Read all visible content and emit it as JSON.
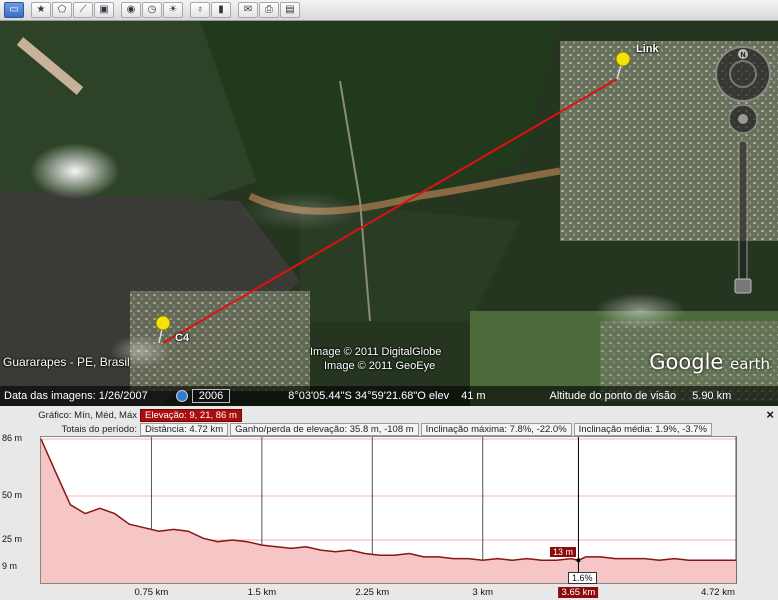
{
  "toolbar": {
    "buttons": [
      {
        "name": "sidebar-toggle-icon",
        "glyph": "▭",
        "active": true
      },
      {
        "name": "placemark-icon",
        "glyph": "★"
      },
      {
        "name": "polygon-icon",
        "glyph": "⬠"
      },
      {
        "name": "path-icon",
        "glyph": "⟋"
      },
      {
        "name": "image-overlay-icon",
        "glyph": "▣"
      },
      {
        "name": "tour-icon",
        "glyph": "◉"
      },
      {
        "name": "historical-imagery-icon",
        "glyph": "◷"
      },
      {
        "name": "sunlight-icon",
        "glyph": "☀"
      },
      {
        "name": "planet-icon",
        "glyph": "♁"
      },
      {
        "name": "ruler-icon",
        "glyph": "▮"
      },
      {
        "name": "email-icon",
        "glyph": "✉"
      },
      {
        "name": "print-icon",
        "glyph": "⎙"
      },
      {
        "name": "save-image-icon",
        "glyph": "▤"
      }
    ]
  },
  "map": {
    "pins": {
      "link": "Link",
      "c4": "C4"
    },
    "place_label": "Guararapes - PE, Brasil",
    "credit1": "Image © 2011 DigitalGlobe",
    "credit2": "Image © 2011 GeoEye",
    "logo_word": "Google",
    "logo_suffix": "earth",
    "path_color": "#e01010"
  },
  "status": {
    "date_label": "Data das imagens: 1/26/2007",
    "year": "2006",
    "coords": "8°03'05.44\"S   34°59'21.68\"O  elev",
    "elev": "41 m",
    "eye_label": "Altitude do ponto de visão",
    "eye_value": "5.90 km"
  },
  "profile": {
    "row1_label": "Gráfico: Mín, Méd, Máx",
    "elevation_summary": "Elevação: 9, 21, 86 m",
    "row2_label": "Totais do período:",
    "distance": "Distância: 4.72 km",
    "gain_loss": "Ganho/perda de elevação: 35.8 m, -108 m",
    "max_slope": "Inclinação máxima: 7.8%, -22.0%",
    "avg_slope": "Inclinação média: 1.9%, -3.7%",
    "close": "×",
    "cursor_elev": "13 m",
    "cursor_slope": "1.6%",
    "cursor_dist": "3.65 km",
    "fill_color": "#f6c6c6",
    "line_color": "#8a1414"
  },
  "chart_data": {
    "type": "area",
    "xlabel": "",
    "ylabel": "",
    "y_ticks": [
      "86 m",
      "50 m",
      "25 m",
      "9 m"
    ],
    "x_ticks": [
      "0.75 km",
      "1.5 km",
      "2.25 km",
      "3 km",
      "3.65 km",
      "4.72 km"
    ],
    "xlim": [
      0,
      4.72
    ],
    "ylim": [
      9,
      86
    ],
    "x": [
      0,
      0.1,
      0.2,
      0.3,
      0.4,
      0.5,
      0.6,
      0.7,
      0.8,
      0.9,
      1.0,
      1.1,
      1.2,
      1.3,
      1.4,
      1.5,
      1.6,
      1.7,
      1.8,
      1.9,
      2.0,
      2.1,
      2.2,
      2.3,
      2.4,
      2.5,
      2.6,
      2.7,
      2.8,
      2.9,
      3.0,
      3.1,
      3.2,
      3.3,
      3.4,
      3.5,
      3.6,
      3.65,
      3.7,
      3.8,
      3.9,
      4.0,
      4.1,
      4.2,
      4.3,
      4.4,
      4.5,
      4.6,
      4.72
    ],
    "y": [
      86,
      65,
      45,
      40,
      43,
      40,
      34,
      32,
      30,
      31,
      30,
      26,
      24,
      25,
      24,
      22,
      21,
      20,
      21,
      19,
      18,
      19,
      17,
      16,
      16,
      17,
      15,
      15,
      14,
      14,
      13,
      14,
      13,
      14,
      13,
      13,
      14,
      13,
      15,
      15,
      14,
      14,
      14,
      13,
      14,
      13,
      13,
      13,
      13
    ]
  }
}
